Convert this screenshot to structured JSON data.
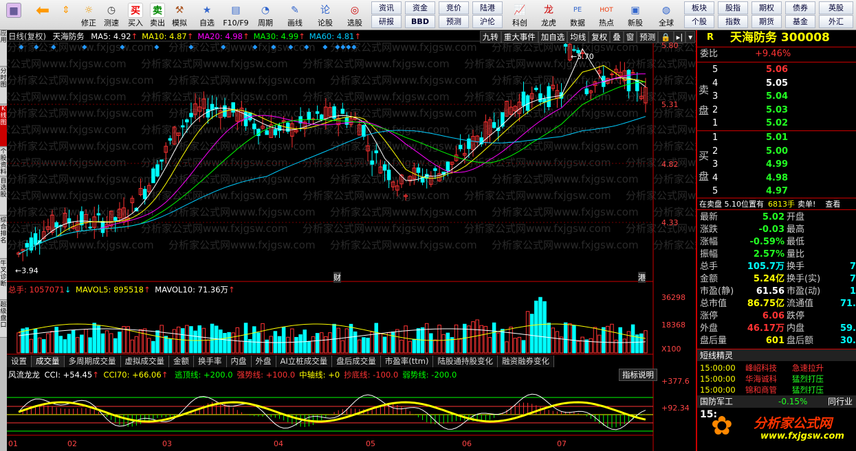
{
  "toolbar": {
    "main": [
      {
        "label": "",
        "icon": "back-arrow-icon"
      },
      {
        "label": "修正",
        "icon": "fix-icon"
      },
      {
        "label": "测速",
        "icon": "speed-icon"
      },
      {
        "label": "买入",
        "icon": "buy-icon"
      },
      {
        "label": "卖出",
        "icon": "sell-icon"
      },
      {
        "label": "模拟",
        "icon": "hammer-icon"
      },
      {
        "label": "自选",
        "icon": "star-icon"
      },
      {
        "label": "F10/F9",
        "icon": "f10-icon"
      },
      {
        "label": "周期",
        "icon": "clock-icon"
      },
      {
        "label": "画线",
        "icon": "pen-icon"
      },
      {
        "label": "论股",
        "icon": "chat-icon"
      },
      {
        "label": "选股",
        "icon": "select-icon"
      }
    ],
    "small": [
      [
        "资讯",
        "资金",
        "竞价",
        "陆港"
      ],
      [
        "研报",
        "BBD",
        "预测",
        "沪伦"
      ]
    ],
    "right": [
      {
        "label": "科创"
      },
      {
        "label": "龙虎"
      },
      {
        "label": "数据"
      },
      {
        "label": "热点"
      },
      {
        "label": "新股"
      },
      {
        "label": "全球"
      }
    ],
    "markets": [
      [
        "板块",
        "股指",
        "期权",
        "债券",
        "英股"
      ],
      [
        "个股",
        "指数",
        "期货",
        "基金",
        "外汇"
      ]
    ],
    "buy_glyph": "买",
    "sell_glyph": "卖"
  },
  "leftbar": [
    "应用",
    "分时图",
    "K线图",
    "个股资料",
    "自选股",
    "综合排名",
    "牛叉诊断",
    "超级盘口"
  ],
  "kline": {
    "period_label": "日线(复权)",
    "stock_name": "天海防务",
    "ma": [
      {
        "label": "MA5: 4.92",
        "color": "#fff"
      },
      {
        "label": "MA10: 4.87",
        "color": "#ff0"
      },
      {
        "label": "MA20: 4.98",
        "color": "#f0f"
      },
      {
        "label": "MA30: 4.99",
        "color": "#0f0"
      },
      {
        "label": "MA60: 4.81",
        "color": "#0cf"
      }
    ],
    "buttons": [
      "九转",
      "重大事件",
      "加自选",
      "均线",
      "复权",
      "叠",
      "窗",
      "预测"
    ],
    "price_axis": [
      "5.80",
      "5.31",
      "4.82",
      "4.33"
    ],
    "high_label": "5.70",
    "low_label": "3.94",
    "marker_cai": "财",
    "marker_gang": "港",
    "watermark": "分析家公式网www.fxjgsw.com"
  },
  "volume": {
    "total": "总手: 1057071",
    "mavol5": "MAVOL5: 895518",
    "mavol10": "MAVOL10: 71.36万",
    "axis": [
      "36298",
      "18368",
      "X100"
    ]
  },
  "tabs": [
    "设置",
    "成交量",
    "多周期成交量",
    "虚拟成交量",
    "金额",
    "换手率",
    "内盘",
    "外盘",
    "AI立桩成交量",
    "盘后成交量",
    "市盈率(ttm)",
    "陆股通持股变化",
    "融资融券变化"
  ],
  "indicator": {
    "name": "风流龙龙",
    "cci": "CCI: +54.45",
    "cci70": "CCI70: +66.06",
    "lines": [
      {
        "label": "逃顶线: +200.0",
        "color": "#0f0"
      },
      {
        "label": "强势线: +100.0",
        "color": "#f33"
      },
      {
        "label": "中轴线: +0",
        "color": "#ff0"
      },
      {
        "label": "抄底线: -100.0",
        "color": "#f33"
      },
      {
        "label": "弱势线: -200.0",
        "color": "#0f0"
      }
    ],
    "help": "指标说明",
    "axis": [
      "+377.6",
      "+92.34"
    ]
  },
  "months": [
    "01",
    "02",
    "03",
    "04",
    "05",
    "06",
    "07"
  ],
  "quote": {
    "code_label": "R",
    "title": "天海防务 300008",
    "webi_label": "委比",
    "webi": "+9.46%",
    "sell_label": [
      "卖",
      "盘"
    ],
    "buy_label": [
      "买",
      "盘"
    ],
    "asks": [
      [
        "5",
        "5.06"
      ],
      [
        "4",
        "5.05"
      ],
      [
        "3",
        "5.04"
      ],
      [
        "2",
        "5.03"
      ],
      [
        "1",
        "5.02"
      ]
    ],
    "bids": [
      [
        "1",
        "5.01"
      ],
      [
        "2",
        "5.00"
      ],
      [
        "3",
        "4.99"
      ],
      [
        "4",
        "4.98"
      ],
      [
        "5",
        "4.97"
      ]
    ],
    "alert": "在卖盘 5.10位置有",
    "alert_vol": "6813手",
    "alert_tag": "卖单!",
    "alert_more": "查看",
    "stats": [
      [
        "最新",
        "5.02",
        "开盘",
        ""
      ],
      [
        "涨跌",
        "-0.03",
        "最高",
        ""
      ],
      [
        "涨幅",
        "-0.59%",
        "最低",
        ""
      ],
      [
        "振幅",
        "2.57%",
        "量比",
        ""
      ],
      [
        "总手",
        "105.7万",
        "换手",
        "7"
      ],
      [
        "金额",
        "5.24亿",
        "换手(实)",
        "7"
      ],
      [
        "市盈(静)",
        "61.56",
        "市盈(动)",
        "1"
      ],
      [
        "总市值",
        "86.75亿",
        "流通值",
        "71."
      ],
      [
        "涨停",
        "6.06",
        "跌停",
        ""
      ],
      [
        "外盘",
        "46.17万",
        "内盘",
        "59."
      ],
      [
        "盘后量",
        "601",
        "盘后额",
        "30."
      ]
    ],
    "elf_title": "短线精灵",
    "elf": [
      [
        "15:00:00",
        "峰岹科技",
        "急速拉升"
      ],
      [
        "15:00:00",
        "华海诚科",
        "猛烈打压"
      ],
      [
        "15:00:00",
        "锦和商管",
        "猛烈打压"
      ]
    ],
    "sector": "国防军工",
    "sector_pct": "-0.15%",
    "sector_tag": "同行业",
    "time": "15:",
    "brand": "分析家公式网",
    "brand_url": "www.fxjgsw.com"
  }
}
